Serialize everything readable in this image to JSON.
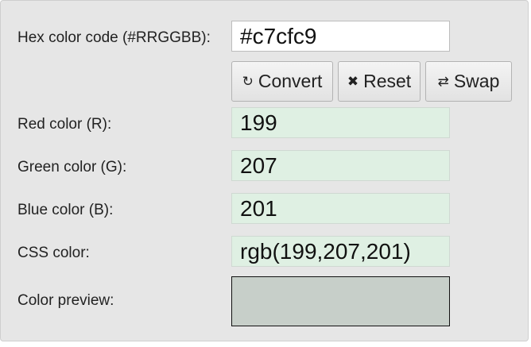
{
  "form": {
    "hex_label": "Hex color code (#RRGGBB):",
    "hex_value": "#c7cfc9",
    "red_label": "Red color (R):",
    "red_value": "199",
    "green_label": "Green color (G):",
    "green_value": "207",
    "blue_label": "Blue color (B):",
    "blue_value": "201",
    "css_label": "CSS color:",
    "css_value": "rgb(199,207,201)",
    "preview_label": "Color preview:",
    "preview_color": "#c7cfc9"
  },
  "buttons": {
    "convert_label": "Convert",
    "convert_icon": "refresh-icon",
    "reset_label": "Reset",
    "reset_icon": "close-icon",
    "swap_label": "Swap",
    "swap_icon": "swap-icon"
  }
}
